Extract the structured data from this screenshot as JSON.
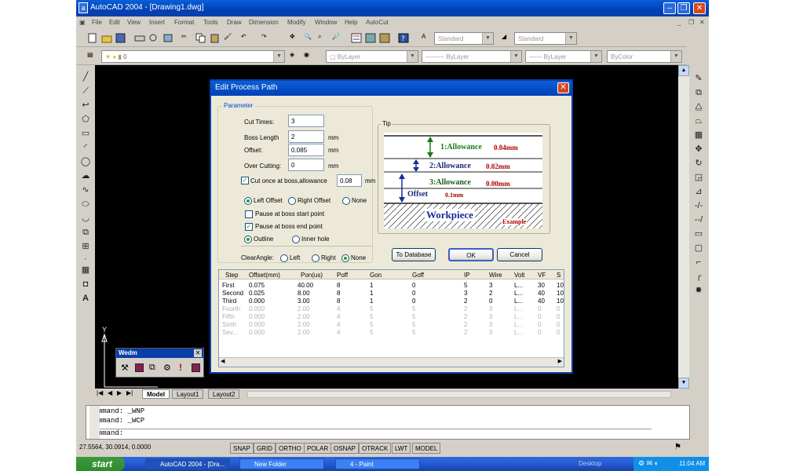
{
  "app": {
    "title": "AutoCAD 2004 - [Drawing1.dwg]",
    "icon": "autocad-icon"
  },
  "menu": [
    "File",
    "Edit",
    "View",
    "Insert",
    "Format",
    "Tools",
    "Draw",
    "Dimension",
    "Modify",
    "Window",
    "Help",
    "AutoCut"
  ],
  "toolbar": {
    "text_style": "Standard",
    "dim_style": "Standard",
    "layer": "0",
    "color": "ByLayer",
    "linetype": "ByLayer",
    "lineweight": "ByLayer",
    "plotstyle": "ByColor"
  },
  "tabs": {
    "model": "Model",
    "layout1": "Layout1",
    "layout2": "Layout2"
  },
  "commands": [
    "Command:  _WNP",
    "Command:  _WCP",
    "Command:"
  ],
  "status": {
    "coords": "27.5564, 30.0914, 0.0000",
    "buttons": [
      "SNAP",
      "GRID",
      "ORTHO",
      "POLAR",
      "OSNAP",
      "OTRACK",
      "LWT",
      "MODEL"
    ]
  },
  "taskbar": {
    "start": "start",
    "tasks": [
      "AutoCAD 2004 - [Dra...",
      "New Folder",
      "4 - Paint"
    ],
    "desktop": "Desktop",
    "time": "11:04 AM"
  },
  "wedm": {
    "title": "Wedm"
  },
  "ucs": {
    "y": "Y",
    "x": "X"
  },
  "dialog": {
    "title": "Edit Process Path",
    "parameter_label": "Parameter",
    "cut_times_label": "Cut Times:",
    "cut_times": "3",
    "boss_length_label": "Boss Length",
    "boss_length": "2",
    "offset_label": "Offset:",
    "offset": "0.085",
    "over_cutting_label": "Over Cutting:",
    "over_cutting": "0",
    "unit": "mm",
    "cut_once_label": "Cut once at boss,allowance",
    "cut_once_value": "0.08",
    "left_offset": "Left Offset",
    "right_offset": "Right Offset",
    "none": "None",
    "pause_start": "Pause at boss start point",
    "pause_end": "Pause at boss end point",
    "outline": "Outline",
    "inner_hole": "Inner hole",
    "clear_angle_label": "ClearAngle:",
    "left": "Left",
    "right": "Right",
    "tip_label": "Tip",
    "tip": {
      "allowance1_label": "1:Allowance",
      "allowance1_value": "0.04mm",
      "allowance2_label": "2:Allowance",
      "allowance2_value": "0.02mm",
      "allowance3_label": "3:Allowance",
      "allowance3_value": "0.00mm",
      "offset_label": "Offset",
      "offset_value": "0.1mm",
      "workpiece": "Workpiece",
      "example": "Example"
    },
    "to_database": "To Database",
    "ok": "OK",
    "cancel": "Cancel",
    "table": {
      "headers": [
        "Step",
        "Offset(mm)",
        "Pon(us)",
        "Poff",
        "Gon",
        "Goff",
        "IP",
        "Wire",
        "Volt",
        "VF",
        "S"
      ],
      "rows": [
        [
          "First",
          "0.075",
          "40.00",
          "8",
          "1",
          "0",
          "5",
          "3",
          "L...",
          "30",
          "10"
        ],
        [
          "Second",
          "0.025",
          "8.00",
          "8",
          "1",
          "0",
          "3",
          "2",
          "L...",
          "40",
          "10"
        ],
        [
          "Third",
          "0.000",
          "3.00",
          "8",
          "1",
          "0",
          "2",
          "0",
          "L...",
          "40",
          "10"
        ],
        [
          "Fourth",
          "0.000",
          "2.00",
          "4",
          "5",
          "5",
          "2",
          "3",
          "L...",
          "0",
          "0"
        ],
        [
          "Fifth",
          "0.000",
          "2.00",
          "4",
          "5",
          "5",
          "2",
          "3",
          "L...",
          "0",
          "0"
        ],
        [
          "Sixth",
          "0.000",
          "2.00",
          "4",
          "5",
          "5",
          "2",
          "3",
          "L...",
          "0",
          "0"
        ],
        [
          "Sev...",
          "0.000",
          "2.00",
          "4",
          "5",
          "5",
          "2",
          "3",
          "L...",
          "0",
          "0"
        ]
      ]
    }
  }
}
